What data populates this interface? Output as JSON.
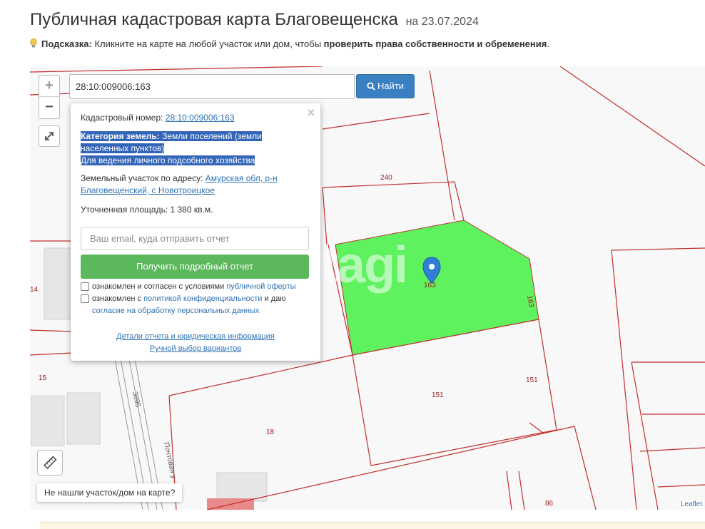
{
  "header": {
    "title": "Публичная кадастровая карта Благовещенска",
    "date": "на 23.07.2024"
  },
  "hint": {
    "label": "Подсказка:",
    "text": "Кликните на карте на любой участок или дом, чтобы",
    "emphasis": "проверить права собственности и обременения",
    "tail": "."
  },
  "search": {
    "value": "28:10:009006:163",
    "button_label": "Найти"
  },
  "zoom": {
    "in": "+",
    "out": "−"
  },
  "popup": {
    "cadastral_label": "Кадастровый номер:",
    "cadastral_value": "28:10:009006:163",
    "category_label": "Категория земель:",
    "category_value_line1": "Земли поселений (земли",
    "category_value_line2": "населенных пунктов)",
    "category_use": "Для ведения личного подсобного хозяйства",
    "address_label": "Земельный участок по адресу:",
    "address_line1": "Амурская обл, р-н",
    "address_line2": "Благовещенский, с Новотроицкое",
    "area_label": "Уточненная площадь:",
    "area_value": "1 380 кв.м.",
    "email_placeholder": "Ваш email, куда отправить отчет",
    "report_button": "Получить подробный отчет",
    "consent1_text": "ознакомлен и согласен с условиями",
    "consent1_link": "публичной оферты",
    "consent2_text": "ознакомлен с",
    "consent2_link": "политикой конфиденциальности",
    "consent2_text2": "и даю",
    "consent2_link2": "согласие на обработку персональных данных",
    "details_link": "Детали отчета и юридическая информация",
    "manual_link": "Ручной выбор вариантов",
    "close": "×"
  },
  "map_labels": {
    "p240": "240",
    "p14": "14",
    "p15": "15",
    "p163_center": "163",
    "p163_side": "163",
    "p151a": "151",
    "p151b": "151",
    "p18": "18",
    "p86": "86",
    "road": "3895",
    "street": "Почтовая у"
  },
  "watermark": "etagi",
  "not_found": "Не нашли участок/дом на карте?",
  "attribution": "Leaflet",
  "colors": {
    "parcel_border": "#c0302e",
    "selected_parcel": "#5ef25e",
    "accent_blue": "#3a7fc1",
    "report_green": "#5cb85c"
  }
}
